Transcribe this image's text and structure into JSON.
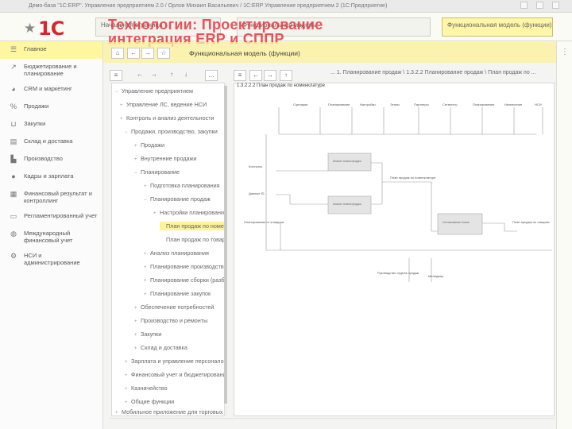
{
  "window": {
    "title": "Демо-база \"1С:ERP\". Управление предприятием 2.0 / Орлов Михаил Васильевич / 1С:ERP Управление предприятием 2 (1С:Предприятие)"
  },
  "slide": {
    "title_line1": "Технологии: Проектирование",
    "title_line2": "интеграция ERP и СППР"
  },
  "top_tabs": [
    {
      "label": "Начальная страница"
    },
    {
      "label": "Функциональная модель"
    },
    {
      "label": "Функциональная модель (функции)"
    }
  ],
  "sidebar": {
    "items": [
      {
        "label": "Главное",
        "icon": "menu-icon"
      },
      {
        "label": "Бюджетирование и планирование",
        "icon": "chart-icon"
      },
      {
        "label": "CRM и маркетинг",
        "icon": "people-icon"
      },
      {
        "label": "Продажи",
        "icon": "percent-icon"
      },
      {
        "label": "Закупки",
        "icon": "cart-icon"
      },
      {
        "label": "Склад и доставка",
        "icon": "box-icon"
      },
      {
        "label": "Производство",
        "icon": "factory-icon"
      },
      {
        "label": "Кадры и зарплата",
        "icon": "person-icon"
      },
      {
        "label": "Финансовый результат и контроллинг",
        "icon": "grid-icon"
      },
      {
        "label": "Регламентированный учет",
        "icon": "document-icon"
      },
      {
        "label": "Международный финансовый учет",
        "icon": "globe-icon"
      },
      {
        "label": "НСИ и администрирование",
        "icon": "gear-icon"
      }
    ]
  },
  "content": {
    "title": "Функциональная модель (функции)"
  },
  "diagram": {
    "header": "1.3.2.2.2 План продаж по номенклатуре",
    "breadcrumb": "... 1. Планирование продаж \\ 1.3.2.2 Планирование продаж \\ План продаж по ..."
  },
  "tree": [
    {
      "label": "Управление предприятием",
      "toggle": "−"
    },
    {
      "label": "Управление ЛС, ведение НСИ",
      "toggle": "+"
    },
    {
      "label": "Контроль и анализ деятельности",
      "toggle": "+"
    },
    {
      "label": "Продажи, производство, закупки",
      "toggle": "−"
    },
    {
      "label": "Продажи",
      "toggle": "+"
    },
    {
      "label": "Внутренние продажи",
      "toggle": "+"
    },
    {
      "label": "Планирование",
      "toggle": "−"
    },
    {
      "label": "Подготовка планирования",
      "toggle": "+"
    },
    {
      "label": "Планирование продаж",
      "toggle": "−"
    },
    {
      "label": "Настройки планирования",
      "toggle": "+"
    },
    {
      "label": "План продаж по номенклатуре",
      "toggle": ""
    },
    {
      "label": "План продаж по товарам",
      "toggle": ""
    },
    {
      "label": "Анализ планирования",
      "toggle": "+"
    },
    {
      "label": "Планирование производства",
      "toggle": "+"
    },
    {
      "label": "Планирование сборки (разборки)",
      "toggle": "+"
    },
    {
      "label": "Планирование закупок",
      "toggle": "+"
    },
    {
      "label": "Обеспечение потребностей",
      "toggle": "+"
    },
    {
      "label": "Производство и ремонты",
      "toggle": "+"
    },
    {
      "label": "Закупки",
      "toggle": "+"
    },
    {
      "label": "Склад и доставка",
      "toggle": "+"
    },
    {
      "label": "Зарплата и управление персоналом",
      "toggle": "+"
    },
    {
      "label": "Финансовый учет и бюджетирование",
      "toggle": "+"
    },
    {
      "label": "Казначейство",
      "toggle": "+"
    },
    {
      "label": "Общие функции",
      "toggle": "+"
    },
    {
      "label": "Мобильное приложение для торговых",
      "toggle": "+"
    }
  ]
}
